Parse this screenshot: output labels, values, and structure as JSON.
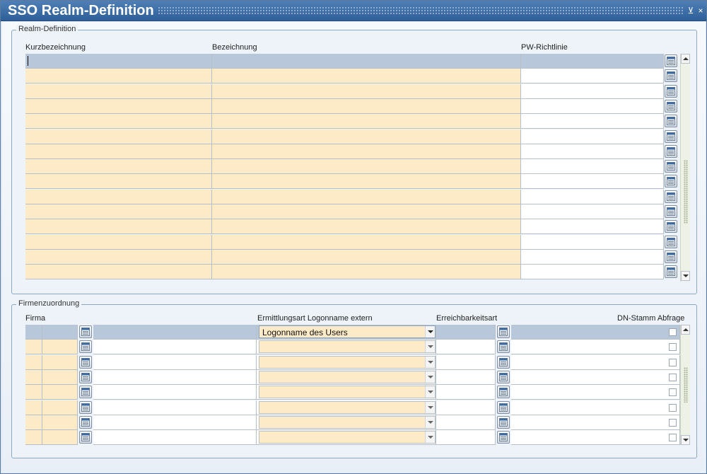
{
  "window": {
    "title": "SSO Realm-Definition",
    "controls": {
      "minimize": "⊻",
      "close": "×"
    }
  },
  "realm": {
    "legend": "Realm-Definition",
    "columns": {
      "kurz": "Kurzbezeichnung",
      "bezeichnung": "Bezeichnung",
      "pw": "PW-Richtlinie"
    },
    "rows": [
      {
        "kurz": "",
        "bezeichnung": "",
        "pw": ""
      },
      {
        "kurz": "",
        "bezeichnung": "",
        "pw": ""
      },
      {
        "kurz": "",
        "bezeichnung": "",
        "pw": ""
      },
      {
        "kurz": "",
        "bezeichnung": "",
        "pw": ""
      },
      {
        "kurz": "",
        "bezeichnung": "",
        "pw": ""
      },
      {
        "kurz": "",
        "bezeichnung": "",
        "pw": ""
      },
      {
        "kurz": "",
        "bezeichnung": "",
        "pw": ""
      },
      {
        "kurz": "",
        "bezeichnung": "",
        "pw": ""
      },
      {
        "kurz": "",
        "bezeichnung": "",
        "pw": ""
      },
      {
        "kurz": "",
        "bezeichnung": "",
        "pw": ""
      },
      {
        "kurz": "",
        "bezeichnung": "",
        "pw": ""
      },
      {
        "kurz": "",
        "bezeichnung": "",
        "pw": ""
      },
      {
        "kurz": "",
        "bezeichnung": "",
        "pw": ""
      },
      {
        "kurz": "",
        "bezeichnung": "",
        "pw": ""
      },
      {
        "kurz": "",
        "bezeichnung": "",
        "pw": ""
      }
    ]
  },
  "firma": {
    "legend": "Firmenzuordnung",
    "columns": {
      "firma": "Firma",
      "ermittlungsart": "Ermittlungsart Logonname extern",
      "erreichbarkeit": "Erreichbarkeitsart",
      "dnstamm": "DN-Stamm Abfrage"
    },
    "rows": [
      {
        "ermittlungsart": "Logonname des Users",
        "dnstamm": false
      },
      {
        "ermittlungsart": "",
        "dnstamm": false
      },
      {
        "ermittlungsart": "",
        "dnstamm": false
      },
      {
        "ermittlungsart": "",
        "dnstamm": false
      },
      {
        "ermittlungsart": "",
        "dnstamm": false
      },
      {
        "ermittlungsart": "",
        "dnstamm": false
      },
      {
        "ermittlungsart": "",
        "dnstamm": false
      },
      {
        "ermittlungsart": "",
        "dnstamm": false
      }
    ]
  },
  "icons": {
    "lookup": "lookup-list-icon",
    "dropdown": "chevron-down-icon",
    "scroll_up": "arrow-up-icon",
    "scroll_down": "arrow-down-icon"
  },
  "colors": {
    "title_bar": "#3a6aa6",
    "input_yellow": "#fdebc7",
    "header_blue": "#b8c7d9"
  }
}
